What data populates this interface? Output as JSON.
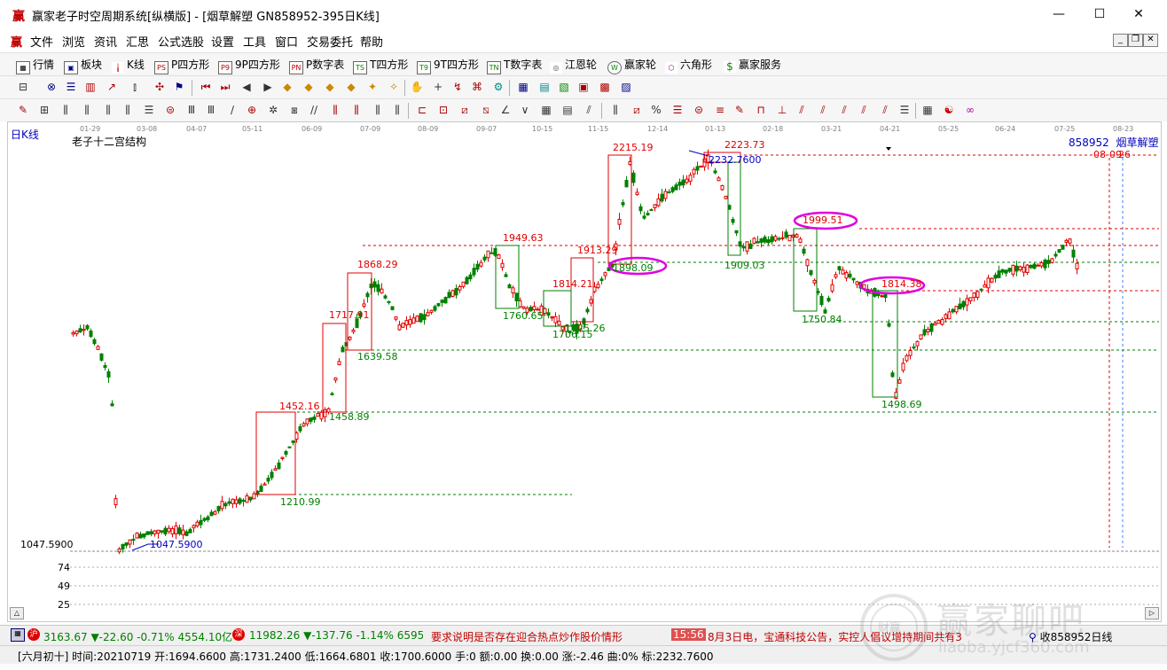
{
  "window": {
    "icon_glyph": "赢",
    "title": "赢家老子时空周期系统[纵横版] - [烟草解塑  GN858952-395日K线]",
    "minimize_glyph": "—",
    "maximize_glyph": "☐",
    "close_glyph": "✕"
  },
  "menu": {
    "icon_glyph": "赢",
    "items": [
      "文件",
      "浏览",
      "资讯",
      "汇思",
      "公式选股",
      "设置",
      "工具",
      "窗口",
      "交易委托",
      "帮助"
    ]
  },
  "toolbar": {
    "items": [
      {
        "label": "行情",
        "icon": "grid-icon"
      },
      {
        "label": "板块",
        "icon": "blocks-icon"
      },
      {
        "label": "K线",
        "icon": "candlestick-icon"
      },
      {
        "label": "P四方形",
        "icon": "ps-icon",
        "badge": "PS"
      },
      {
        "label": "9P四方形",
        "icon": "p9-icon",
        "badge": "P9"
      },
      {
        "label": "P数字表",
        "icon": "pn-icon",
        "badge": "PN"
      },
      {
        "label": "T四方形",
        "icon": "ts-icon",
        "badge": "TS"
      },
      {
        "label": "9T四方形",
        "icon": "t9-icon",
        "badge": "T9"
      },
      {
        "label": "T数字表",
        "icon": "tn-icon",
        "badge": "TN"
      },
      {
        "label": "江恩轮",
        "icon": "gann-wheel-icon",
        "badge": "◎"
      },
      {
        "label": "赢家轮",
        "icon": "winner-wheel-icon",
        "badge": "W"
      },
      {
        "label": "六角形",
        "icon": "hexagon-icon",
        "badge": "⬡"
      },
      {
        "label": "赢家服务",
        "icon": "dollar-icon",
        "badge": "$"
      }
    ]
  },
  "chart": {
    "period_label": "日K线",
    "indicator_title": "老子十二宫结构",
    "stock_label": "858952  烟草解塑",
    "date_marker": "08-09",
    "date_marker2": "26",
    "ylabel_low": "1047.5900",
    "low_label": "1047.5900",
    "top_price": "2232.7600",
    "date_ticks": [
      "01-29",
      "03-08",
      "04-07",
      "05-11",
      "06-09",
      "07-09",
      "08-09",
      "09-07",
      "10-15",
      "11-15",
      "12-14",
      "01-13",
      "02-18",
      "03-21",
      "04-21",
      "05-25",
      "06-24",
      "07-25",
      "08-23"
    ],
    "red_labels": [
      "1452.16",
      "1717.91",
      "1868.29",
      "1949.63",
      "1814.21",
      "1913.29",
      "2215.19",
      "2223.73",
      "1999.51",
      "1814.38"
    ],
    "green_labels": [
      "1210.99",
      "1458.89",
      "1639.58",
      "1760.65",
      "1706.15",
      "1725.26",
      "1898.09",
      "1909.03",
      "1750.84",
      "1498.69"
    ],
    "circled": [
      "1898.09",
      "1999.51",
      "1814.38"
    ],
    "sub_ticks": [
      "74",
      "49",
      "25"
    ]
  },
  "status": {
    "index1": {
      "value": "3163.67",
      "change": "▼-22.60",
      "pct": "-0.71%",
      "amount": "4554.10亿"
    },
    "index2": {
      "value": "11982.26",
      "change": "▼-137.76",
      "pct": "-1.14%",
      "amount": "6595.5"
    },
    "news": "要求说明是否存在迎合热点炒作股价情形",
    "time": "15:56",
    "news2": "8月3日电，宝通科技公告，实控人倡议增持期间共有3",
    "stock_close": "收858952日线"
  },
  "info": {
    "text": "[六月初十] 时间:20210719 开:1694.6600 高:1731.2400 低:1664.6801 收:1700.6000 手:0 额:0.00 换:0.00 涨:-2.46 曲:0% 标:2232.7600"
  },
  "watermark": {
    "logo": "财赢",
    "main": "赢家聊吧",
    "url": "liaoba.yjcf360.com"
  },
  "colors": {
    "up": "#e00000",
    "down": "#008000",
    "blue": "#0000c0",
    "magenta": "#e000e0"
  }
}
